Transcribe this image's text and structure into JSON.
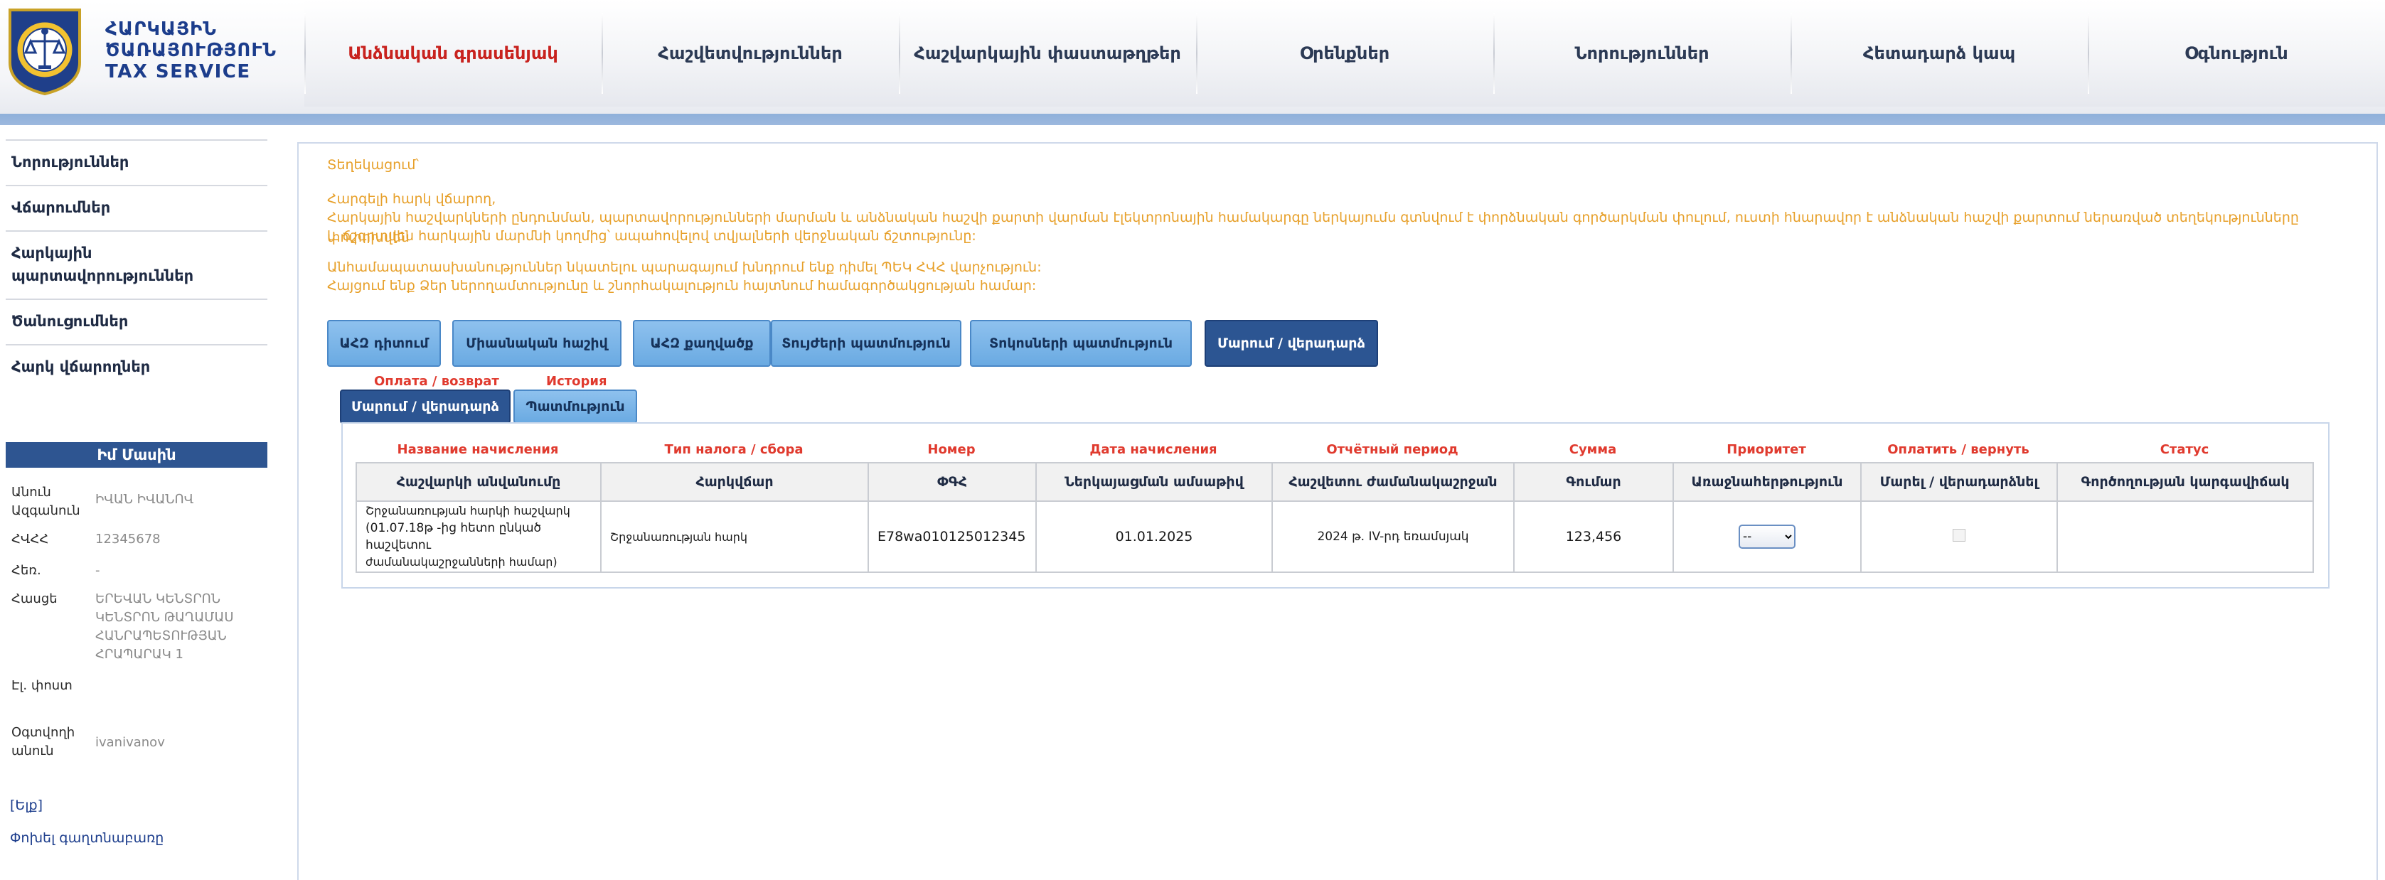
{
  "header": {
    "brand_line1": "ՀԱՐԿԱՅԻՆ",
    "brand_line2": "ԾԱՌԱՅՈՒԹՅՈՒՆ",
    "brand_line3": "TAX SERVICE",
    "nav": [
      {
        "label": "Անձնական գրասենյակ",
        "active": true
      },
      {
        "label": "Հաշվետվություններ",
        "active": false
      },
      {
        "label": "Հաշվարկային փաստաթղթեր",
        "active": false
      },
      {
        "label": "Օրենքներ",
        "active": false
      },
      {
        "label": "Նորություններ",
        "active": false
      },
      {
        "label": "Հետադարձ կապ",
        "active": false
      },
      {
        "label": "Օգնություն",
        "active": false
      }
    ]
  },
  "sidebar": {
    "links": [
      "Նորություններ",
      "Վճարումներ",
      "Հարկային պարտավորություններ",
      "Ծանուցումներ",
      "Հարկ վճարողներ"
    ],
    "about_title": "Իմ Մասին",
    "fields": [
      {
        "label": "Անուն Ազգանուն",
        "value": "ԻՎԱՆ ԻՎԱՆՈՎ"
      },
      {
        "label": "ՀՎՀՀ",
        "value": "12345678"
      },
      {
        "label": "Հեռ.",
        "value": "-"
      },
      {
        "label": "Հասցե",
        "value": "ԵՐԵՎԱՆ ԿԵՆՏՐՈՆ ԿԵՆՏՐՈՆ ԹԱՂԱՄԱՍ ՀԱՆՐԱՊԵՏՈՒԹՅԱՆ ՀՐԱՊԱՐԱԿ 1"
      },
      {
        "label": "Էլ. փոստ",
        "value": ""
      },
      {
        "label": "Օգտվողի անուն",
        "value": "ivanivanov"
      }
    ],
    "exit_link": "[Ելք]",
    "change_password": "Փոխել գաղտնաբառը"
  },
  "notice": {
    "title": "Տեղեկացում՝",
    "greeting": "Հարգելի հարկ վճարող,",
    "line1": "Հարկային հաշվարկների ընդունման, պարտավորությունների մարման և անձնական հաշվի քարտի վարման էլեկտրոնային համակարգը ներկայումս գտնվում է փորձնական գործարկման փուլում, ուստի հնարավոր է անձնական հաշվի քարտում ներառված տեղեկությունները փոփոխվեն",
    "line2": "և ճշգրտվեն հարկային մարմնի կողմից՝ ապահովելով տվյալների վերջնական ճշտությունը:",
    "line3": "Անհամապատասխանություններ նկատելու պարագայում խնդրում ենք դիմել ՊԵԿ ՀՎՀ վարչություն:",
    "line4": "Հայցում ենք Ձեր ներողամտությունը և շնորհակալություն հայտնում համագործակցության համար:"
  },
  "buttons": [
    "ԱՀԶ դիտում",
    "Միասնական հաշիվ",
    "ԱՀԶ քաղվածք",
    "Տույժերի պատմություն",
    "Տոկոսների պատմություն",
    "Մարում / վերադարձ"
  ],
  "subtabs": {
    "caption1": "Оплата / возврат",
    "caption2": "История",
    "tab1": "Մարում / վերադարձ",
    "tab2": "Պատմություն"
  },
  "table": {
    "ru_headers": [
      "Название начисления",
      "Тип налога / сбора",
      "Номер",
      "Дата начисления",
      "Отчётный период",
      "Сумма",
      "Приоритет",
      "Оплатить / вернуть",
      "Статус"
    ],
    "headers": [
      "Հաշվարկի անվանումը",
      "Հարկվճար",
      "ՓԳՀ",
      "Ներկայացման ամսաթիվ",
      "Հաշվետու ժամանակաշրջան",
      "Գումար",
      "Առաջնահերթություն",
      "Մարել / վերադարձնել",
      "Գործողության կարգավիճակ"
    ],
    "row": {
      "name_line1": "Շրջանառության հարկի հաշվարկ",
      "name_line2": "(01.07.18թ -ից հետո ընկած հաշվետու",
      "name_line3": "ժամանակաշրջանների համար)",
      "tax_type": "Շրջանառության հարկ",
      "number": "E78wa010125012345",
      "date": "01.01.2025",
      "period": "2024 թ. IV-րդ եռամսյակ",
      "amount": "123,456",
      "priority": "--"
    }
  }
}
